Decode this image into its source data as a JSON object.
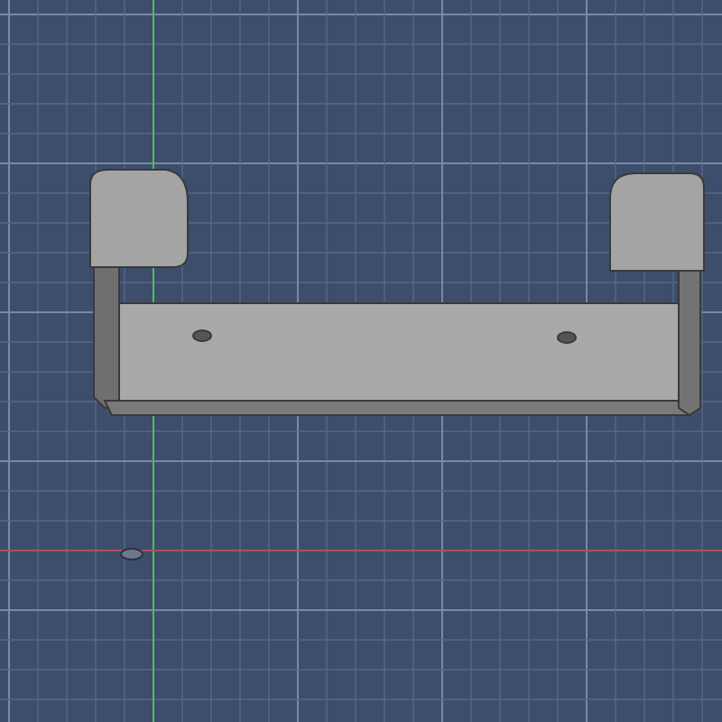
{
  "viewport": {
    "grid": true,
    "axes": true,
    "origin_marker": true
  }
}
